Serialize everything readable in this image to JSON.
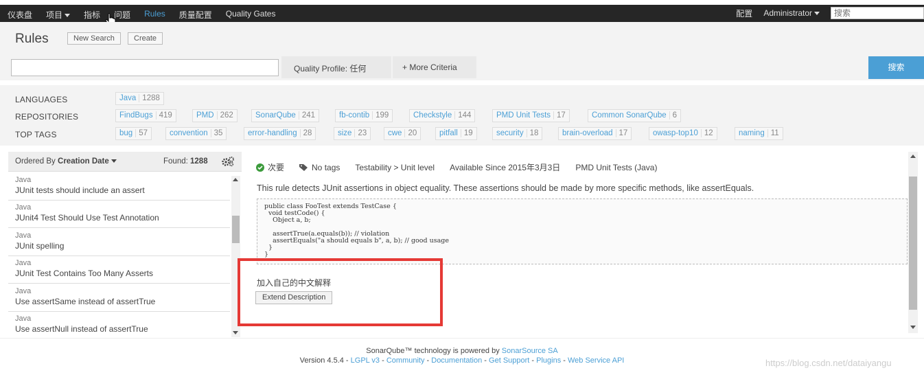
{
  "nav": {
    "items": [
      "仪表盘",
      "项目",
      "指标",
      "问题",
      "Rules",
      "质量配置",
      "Quality Gates"
    ],
    "active": "Rules",
    "config": "配置",
    "user": "Administrator",
    "search_placeholder": "搜索"
  },
  "header": {
    "title": "Rules",
    "new_search": "New Search",
    "create": "Create"
  },
  "search": {
    "quality_profile": "Quality Profile:  任何",
    "more_criteria": "+ More Criteria",
    "button": "搜索"
  },
  "facets": {
    "languages_label": "LANGUAGES",
    "repositories_label": "REPOSITORIES",
    "top_tags_label": "TOP TAGS",
    "languages": [
      {
        "name": "Java",
        "count": "1288"
      }
    ],
    "repositories": [
      {
        "name": "FindBugs",
        "count": "419"
      },
      {
        "name": "PMD",
        "count": "262"
      },
      {
        "name": "SonarQube",
        "count": "241"
      },
      {
        "name": "fb-contib",
        "count": "199"
      },
      {
        "name": "Checkstyle",
        "count": "144"
      },
      {
        "name": "PMD Unit Tests",
        "count": "17"
      },
      {
        "name": "Common SonarQube",
        "count": "6"
      }
    ],
    "tags": [
      {
        "name": "bug",
        "count": "57"
      },
      {
        "name": "convention",
        "count": "35"
      },
      {
        "name": "error-handling",
        "count": "28"
      },
      {
        "name": "size",
        "count": "23"
      },
      {
        "name": "cwe",
        "count": "20"
      },
      {
        "name": "pitfall",
        "count": "19"
      },
      {
        "name": "security",
        "count": "18"
      },
      {
        "name": "brain-overload",
        "count": "17"
      },
      {
        "name": "owasp-top10",
        "count": "12"
      },
      {
        "name": "naming",
        "count": "11"
      }
    ]
  },
  "list": {
    "ordered_prefix": "Ordered By",
    "ordered_value": "Creation Date",
    "found_label": "Found:",
    "found_count": "1288",
    "rules": [
      {
        "lang": "Java",
        "name": "JUnit tests should include an assert"
      },
      {
        "lang": "Java",
        "name": "JUnit4 Test Should Use Test Annotation"
      },
      {
        "lang": "Java",
        "name": "JUnit spelling"
      },
      {
        "lang": "Java",
        "name": "JUnit Test Contains Too Many Asserts"
      },
      {
        "lang": "Java",
        "name": "Use assertSame instead of assertTrue"
      },
      {
        "lang": "Java",
        "name": "Use assertNull instead of assertTrue"
      }
    ]
  },
  "detail": {
    "severity": "次要",
    "tags": "No tags",
    "characteristic": "Testability > Unit level",
    "available_since": "Available Since 2015年3月3日",
    "repository": "PMD Unit Tests (Java)",
    "description": "This rule detects JUnit assertions in object equality. These assertions should be made by more specific methods, like assertEquals.",
    "code": "public class FooTest extends TestCase {\n  void testCode() {\n    Object a, b;\n\n    assertTrue(a.equals(b)); // violation\n    assertEquals(\"a should equals b\", a, b); // good usage\n  }\n}",
    "extension_text": "加入自己的中文解释",
    "extend_button": "Extend Description"
  },
  "footer": {
    "line1_prefix": "SonarQube™ technology is powered by",
    "sonarsource": "SonarSource SA",
    "version": "Version 4.5.4 -",
    "links": [
      "LGPL v3",
      "Community",
      "Documentation",
      "Get Support",
      "Plugins",
      "Web Service API"
    ],
    "watermark": "https://blog.csdn.net/dataiyangu"
  },
  "colors": {
    "accent": "#4b9fd5",
    "nav_bg": "#262626",
    "highlight_box": "#e53935"
  }
}
